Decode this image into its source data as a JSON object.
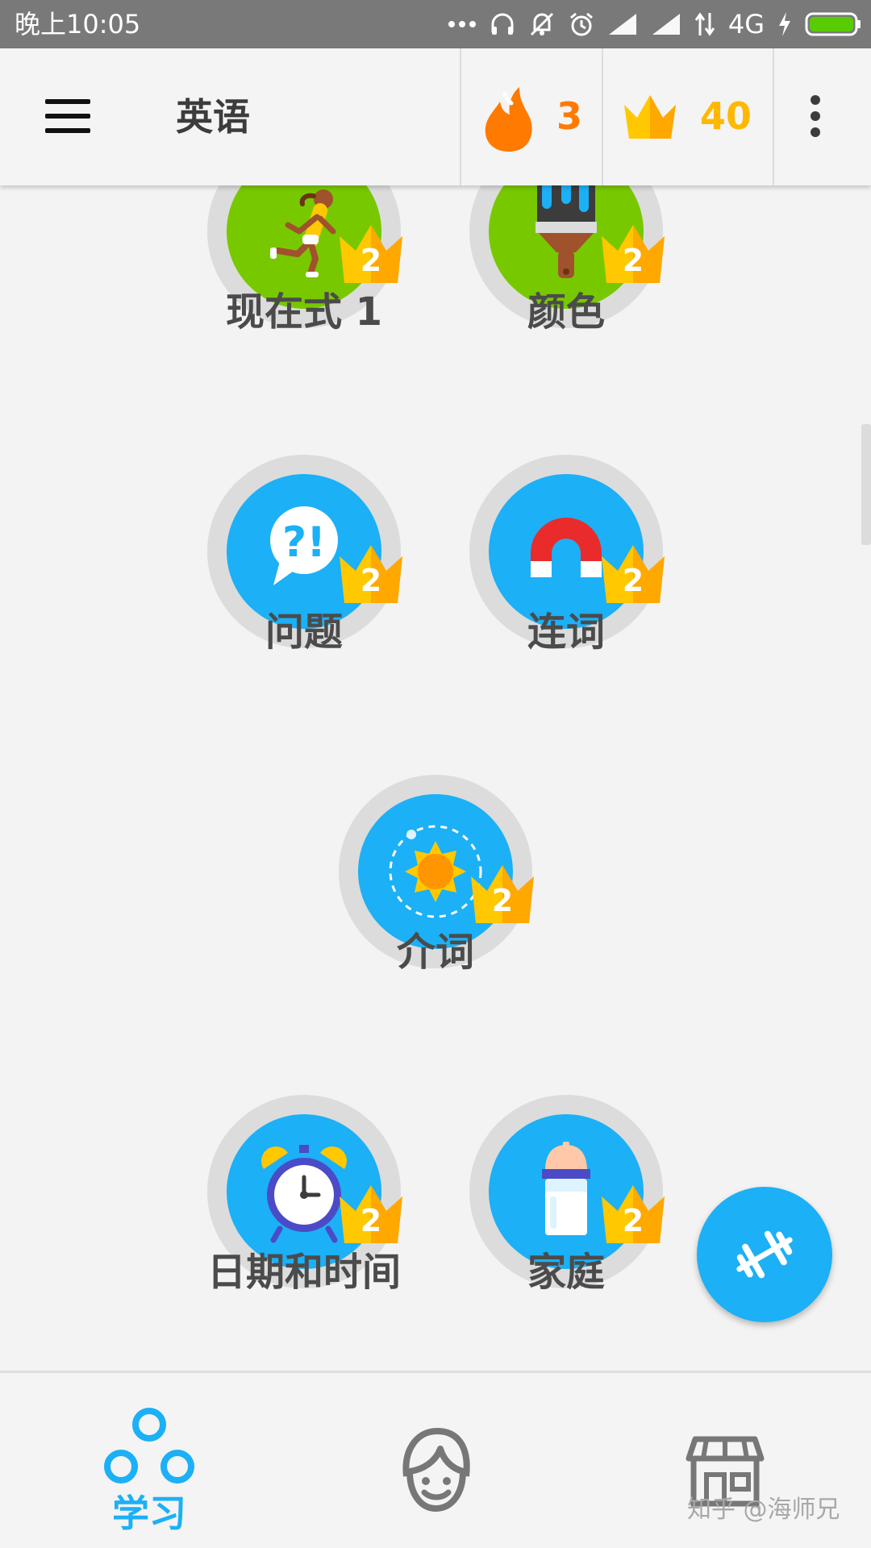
{
  "status_bar": {
    "time": "晚上10:05",
    "network": "4G",
    "icons": [
      "more-dots-icon",
      "headphones-icon",
      "mute-icon",
      "alarm-icon",
      "signal-icon",
      "signal-icon",
      "data-arrows-icon",
      "charging-icon",
      "battery-icon"
    ]
  },
  "app_bar": {
    "menu_icon": "hamburger-icon",
    "title": "英语",
    "streak": {
      "icon": "flame-icon",
      "count": "3",
      "color": "#ff7a00"
    },
    "crowns": {
      "icon": "crown-icon",
      "count": "40",
      "color": "#ffb800"
    },
    "more_icon": "more-vert-icon"
  },
  "skills": [
    {
      "name": "现在式 1",
      "icon": "runner-icon",
      "color": "#78c800",
      "crown_level": "2"
    },
    {
      "name": "颜色",
      "icon": "paintbrush-icon",
      "color": "#78c800",
      "crown_level": "2"
    },
    {
      "name": "问题",
      "icon": "question-bubble-icon",
      "color": "#1cb0f6",
      "crown_level": "2"
    },
    {
      "name": "连词",
      "icon": "magnet-icon",
      "color": "#1cb0f6",
      "crown_level": "2"
    },
    {
      "name": "介词",
      "icon": "sun-orbit-icon",
      "color": "#1cb0f6",
      "crown_level": "2"
    },
    {
      "name": "日期和时间",
      "icon": "alarm-clock-icon",
      "color": "#1cb0f6",
      "crown_level": "2"
    },
    {
      "name": "家庭",
      "icon": "baby-bottle-icon",
      "color": "#1cb0f6",
      "crown_level": "2"
    }
  ],
  "fab": {
    "icon": "dumbbell-icon",
    "color": "#1cb0f6"
  },
  "bottom_nav": {
    "learn": {
      "label": "学习",
      "icon": "learn-circles-icon",
      "color": "#1cb0f6"
    },
    "profile": {
      "icon": "profile-face-icon"
    },
    "shop": {
      "icon": "shop-icon"
    }
  },
  "watermark": "知乎 @海师兄"
}
